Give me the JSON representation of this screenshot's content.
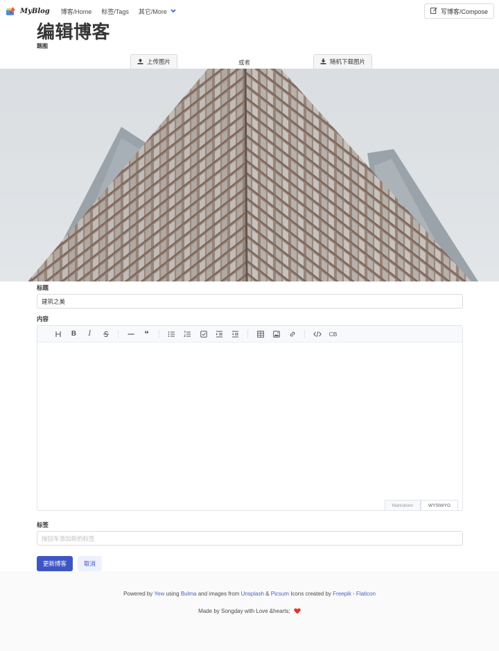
{
  "navbar": {
    "brand": "MyBlog",
    "links": [
      "博客/Home",
      "标签/Tags",
      "其它/More"
    ],
    "compose": "写博客/Compose"
  },
  "page": {
    "title": "编辑博客",
    "cover_label": "题图",
    "upload_label": "上传图片",
    "or_label": "或者",
    "random_label": "随机下载图片"
  },
  "form": {
    "title_label": "标题",
    "title_value": "建筑之美",
    "content_label": "内容",
    "tags_label": "标签",
    "tags_placeholder": "按回车添加新的标签",
    "submit": "更新博客",
    "cancel": "取消"
  },
  "editor": {
    "toolbar": [
      "heading-icon",
      "bold-icon",
      "italic-icon",
      "strike-icon",
      "hr-icon",
      "quote-icon",
      "bullet-list-icon",
      "ordered-list-icon",
      "task-list-icon",
      "indent-icon",
      "outdent-icon",
      "table-icon",
      "image-icon",
      "link-icon",
      "code-icon",
      "codeblock-icon"
    ],
    "codeblock_label": "CB",
    "modes": [
      "Markdown",
      "WYSIWYG"
    ],
    "active_mode": "WYSIWYG"
  },
  "footer": {
    "powered": "Powered by",
    "yew": "Yew",
    "using": "using",
    "bulma": "Bulma",
    "and_images": "and images from",
    "unsplash": "Unsplash",
    "amp": "&",
    "picsum": "Picsum",
    "icons_by": "Icons created by",
    "freepik": "Freepik - Flaticon",
    "made_by": "Made by Songday with Love &hearts;"
  },
  "colors": {
    "primary": "#3e56c4",
    "link": "#485fc7"
  }
}
